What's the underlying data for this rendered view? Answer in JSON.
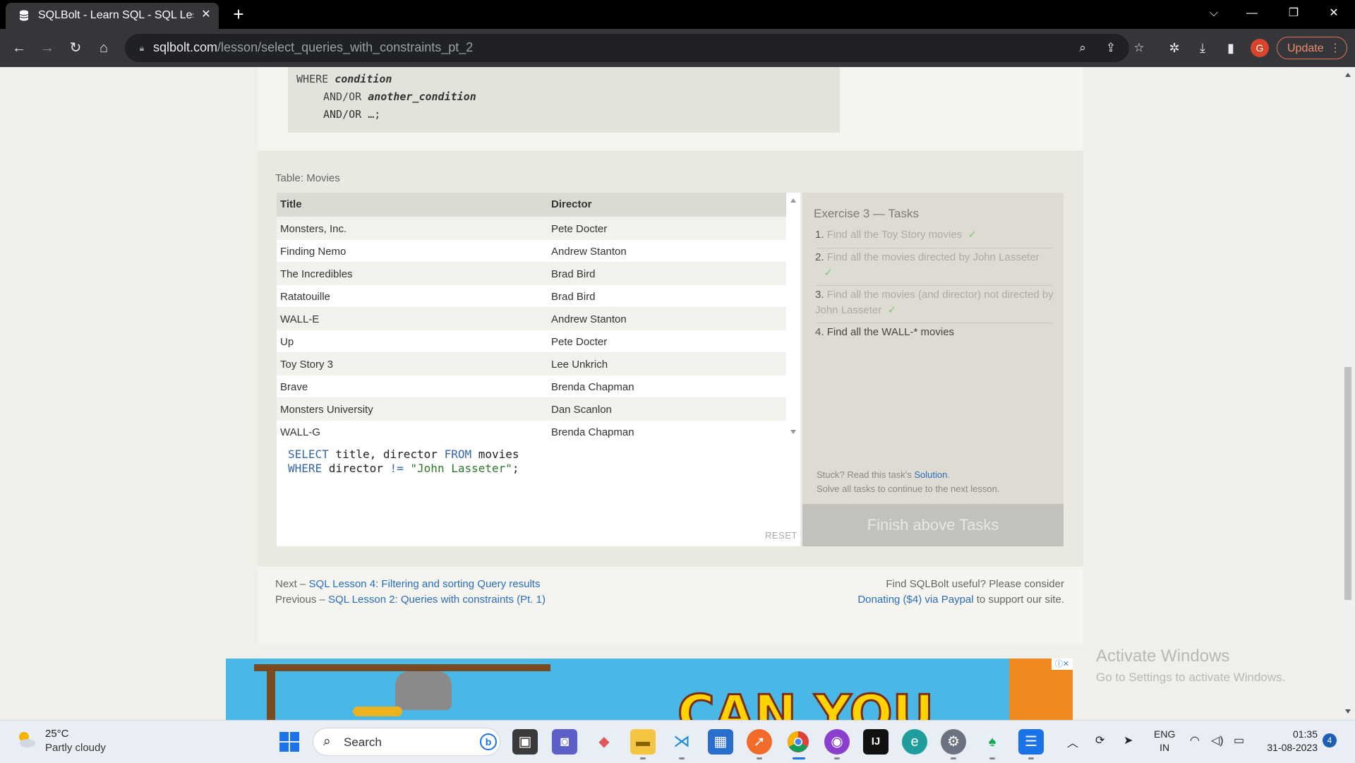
{
  "browser": {
    "tab_title": "SQLBolt - Learn SQL - SQL Lesson",
    "tab_close": "✕",
    "new_tab": "+",
    "url_host": "sqlbolt.com",
    "url_path": "/lesson/select_queries_with_constraints_pt_2",
    "profile_initial": "G",
    "update_label": "Update",
    "menu_glyph": "⋮"
  },
  "syntax": {
    "line_where_kw": "WHERE",
    "line_where_cond": "condition",
    "line_and_kw": "AND/OR",
    "line_and_cond": "another_condition",
    "line_and2": "AND/OR …;"
  },
  "table": {
    "caption": "Table: Movies",
    "headers": [
      "Title",
      "Director"
    ],
    "rows": [
      [
        "Monsters, Inc.",
        "Pete Docter"
      ],
      [
        "Finding Nemo",
        "Andrew Stanton"
      ],
      [
        "The Incredibles",
        "Brad Bird"
      ],
      [
        "Ratatouille",
        "Brad Bird"
      ],
      [
        "WALL-E",
        "Andrew Stanton"
      ],
      [
        "Up",
        "Pete Docter"
      ],
      [
        "Toy Story 3",
        "Lee Unkrich"
      ],
      [
        "Brave",
        "Brenda Chapman"
      ],
      [
        "Monsters University",
        "Dan Scanlon"
      ],
      [
        "WALL-G",
        "Brenda Chapman"
      ]
    ]
  },
  "editor": {
    "line1_k1": "SELECT",
    "line1_t1": " title, director ",
    "line1_k2": "FROM",
    "line1_t2": " movies",
    "line2_k1": "WHERE",
    "line2_t1": " director ",
    "line2_k2": "!=",
    "line2_sp": " ",
    "line2_str": "\"John Lasseter\"",
    "line2_end": ";",
    "reset_label": "RESET"
  },
  "tasks": {
    "title": "Exercise 3 — Tasks",
    "items": [
      {
        "num": "1.",
        "text": "Find all the Toy Story movies",
        "check": "✓"
      },
      {
        "num": "2.",
        "text": "Find all the movies directed by John Lasseter",
        "check": "✓"
      },
      {
        "num": "3.",
        "text": "Find all the movies (and director) not directed by John Lasseter",
        "check": "✓"
      },
      {
        "num": "4.",
        "text": "Find all the WALL-* movies",
        "check": ""
      }
    ],
    "stuck_prefix": "Stuck? Read this task's ",
    "stuck_link": "Solution",
    "stuck_suffix": ".",
    "solve_all": "Solve all tasks to continue to the next lesson.",
    "finish_label": "Finish above Tasks"
  },
  "footer": {
    "next_prefix": "Next – ",
    "next_link": "SQL Lesson 4: Filtering and sorting Query results",
    "prev_prefix": "Previous – ",
    "prev_link": "SQL Lesson 2: Queries with constraints (Pt. 1)",
    "donate_line1": "Find SQLBolt useful? Please consider",
    "donate_link": "Donating ($4) via Paypal",
    "donate_suffix": " to support our site."
  },
  "ad": {
    "text": "CAN YOU",
    "close": "ⓘ✕"
  },
  "watermark": {
    "line1": "Activate Windows",
    "line2": "Go to Settings to activate Windows."
  },
  "taskbar": {
    "temp": "25°C",
    "weather": "Partly cloudy",
    "search_placeholder": "Search",
    "bing_glyph": "b",
    "lang1": "ENG",
    "lang2": "IN",
    "time": "01:35",
    "date": "31-08-2023",
    "notifications": "4"
  },
  "colors": {
    "accent_link": "#2a6ebb",
    "check_green": "#7ec77e",
    "update_orange": "#f28b6c"
  }
}
